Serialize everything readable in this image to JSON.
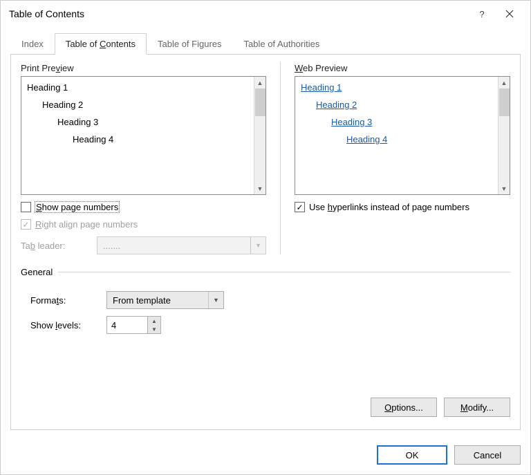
{
  "title": "Table of Contents",
  "tabs": {
    "index": "Index",
    "toc": "Table of Contents",
    "figures": "Table of Figures",
    "authorities": "Table of Authorities"
  },
  "printPreview": {
    "label_pre": "Print Pre",
    "label_u": "v",
    "label_post": "iew",
    "h1": "Heading 1",
    "h2": "Heading 2",
    "h3": "Heading 3",
    "h4": "Heading 4"
  },
  "webPreview": {
    "label_u": "W",
    "label_post": "eb Preview",
    "h1": "Heading 1",
    "h2": "Heading 2",
    "h3": "Heading 3",
    "h4": "Heading 4"
  },
  "options": {
    "show_u": "S",
    "show_post": "how page numbers",
    "right_u": "R",
    "right_post": "ight align page numbers",
    "tableader_pre": "Ta",
    "tableader_u": "b",
    "tableader_post": " leader:",
    "tableader_value": ".......",
    "hyper_pre": "Use ",
    "hyper_u": "h",
    "hyper_post": "yperlinks instead of page numbers"
  },
  "general": {
    "legend": "General",
    "formats_pre": "Forma",
    "formats_u": "t",
    "formats_post": "s:",
    "formats_value": "From template",
    "levels_pre": "Show ",
    "levels_u": "l",
    "levels_post": "evels:",
    "levels_value": "4"
  },
  "buttons": {
    "options_u": "O",
    "options_post": "ptions...",
    "modify_u": "M",
    "modify_post": "odify...",
    "ok": "OK",
    "cancel": "Cancel"
  }
}
